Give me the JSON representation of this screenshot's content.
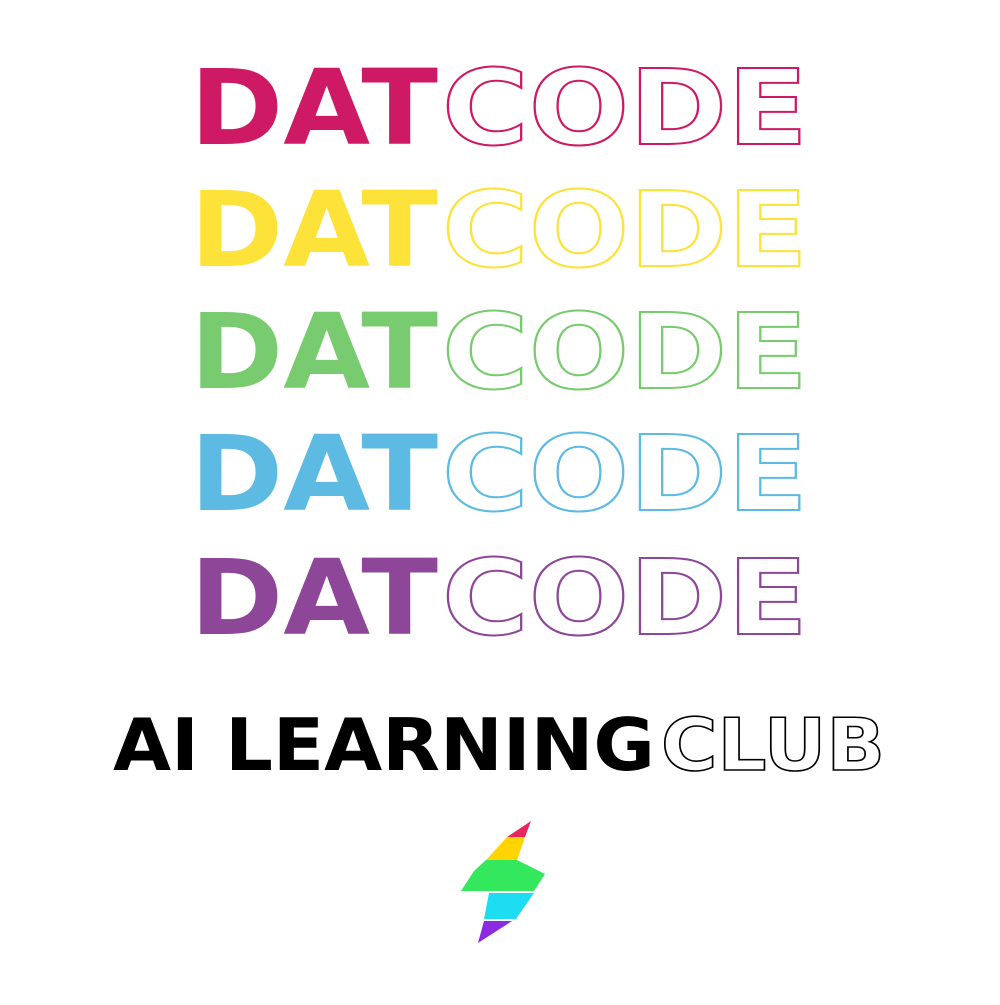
{
  "rows": [
    {
      "solid": "DAT",
      "outline": "CODE",
      "color": "#CE1A64"
    },
    {
      "solid": "DAT",
      "outline": "CODE",
      "color": "#FDE23A"
    },
    {
      "solid": "DAT",
      "outline": "CODE",
      "color": "#78CB6E"
    },
    {
      "solid": "DAT",
      "outline": "CODE",
      "color": "#5DBAE2"
    },
    {
      "solid": "DAT",
      "outline": "CODE",
      "color": "#8E4798"
    }
  ],
  "tagline": {
    "solid": "AI LEARNING",
    "outline": "CLUB",
    "color": "#000000"
  },
  "logo": {
    "icon": "lightning-bolt-icon",
    "colors": [
      "#E8265E",
      "#FFD400",
      "#34E85E",
      "#1EDCF2",
      "#8A2BE2"
    ]
  }
}
